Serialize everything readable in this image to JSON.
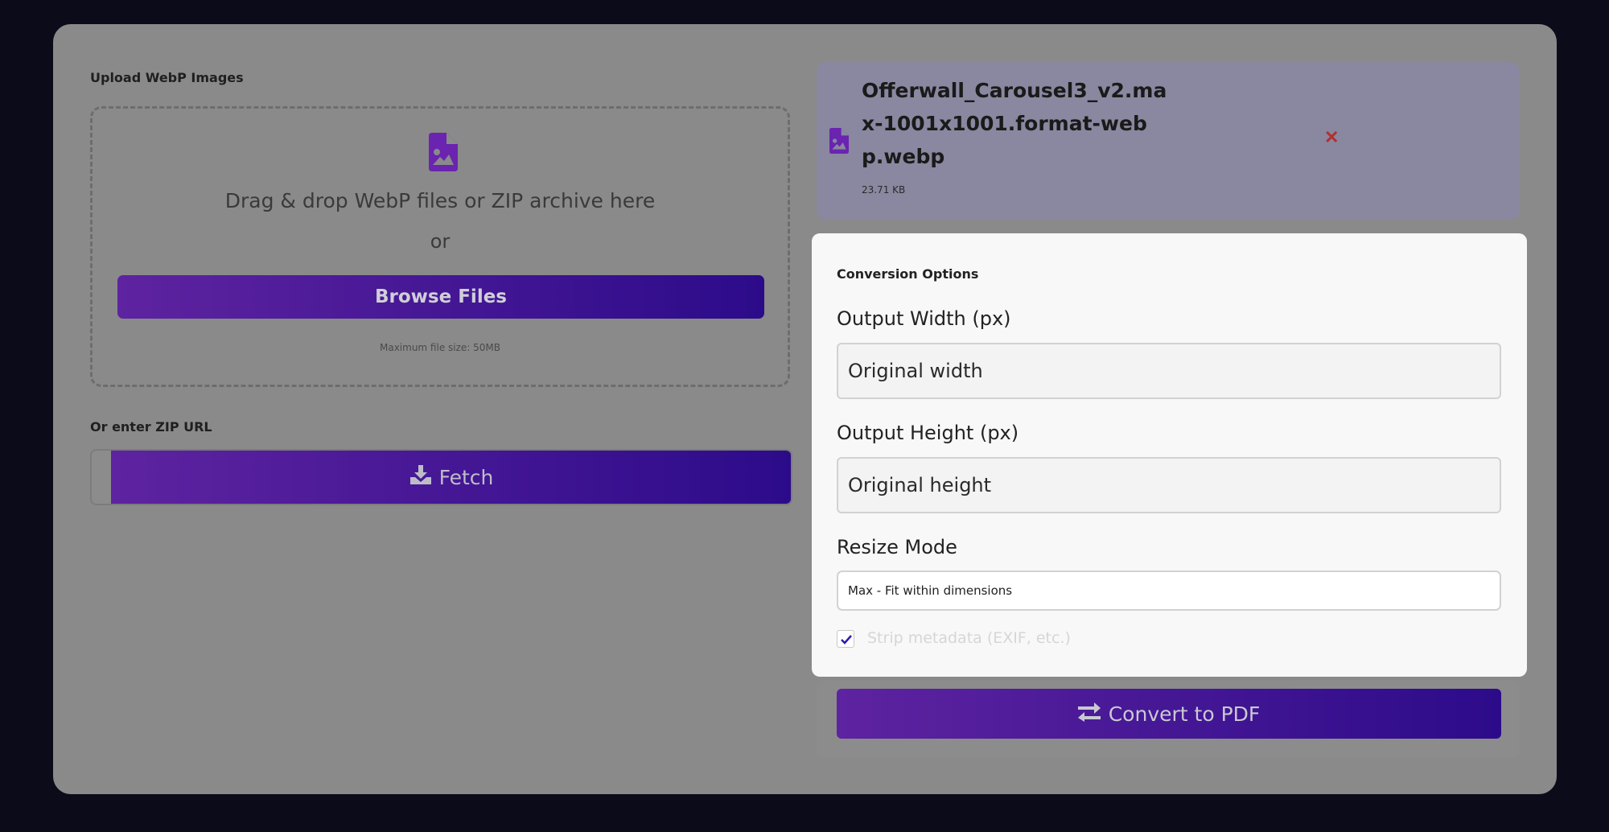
{
  "upload": {
    "label": "Upload WebP Images",
    "drop_text": "Drag & drop WebP files or ZIP archive here",
    "or_text": "or",
    "browse_label": "Browse Files",
    "max_size": "Maximum file size: 50MB"
  },
  "zip": {
    "label": "Or enter ZIP URL",
    "fetch_label": "Fetch"
  },
  "file": {
    "name": "Offerwall_Carousel3_v2.max-1001x1001.format-webp.webp",
    "size": "23.71 KB",
    "remove_symbol": "✕"
  },
  "options": {
    "title": "Conversion Options",
    "width_label": "Output Width (px)",
    "width_placeholder": "Original width",
    "height_label": "Output Height (px)",
    "height_placeholder": "Original height",
    "resize_label": "Resize Mode",
    "resize_value": "Max - Fit within dimensions",
    "strip_label": "Strip metadata (EXIF, etc.)",
    "strip_checked": true
  },
  "convert": {
    "label": "Convert to PDF"
  },
  "colors": {
    "accent_start": "#5e23a0",
    "accent_end": "#2c0b8a",
    "remove": "#b03030",
    "file_icon": "#6a24b0"
  },
  "icons": [
    "file-image-icon",
    "download-icon",
    "close-icon",
    "check-icon",
    "exchange-icon"
  ]
}
